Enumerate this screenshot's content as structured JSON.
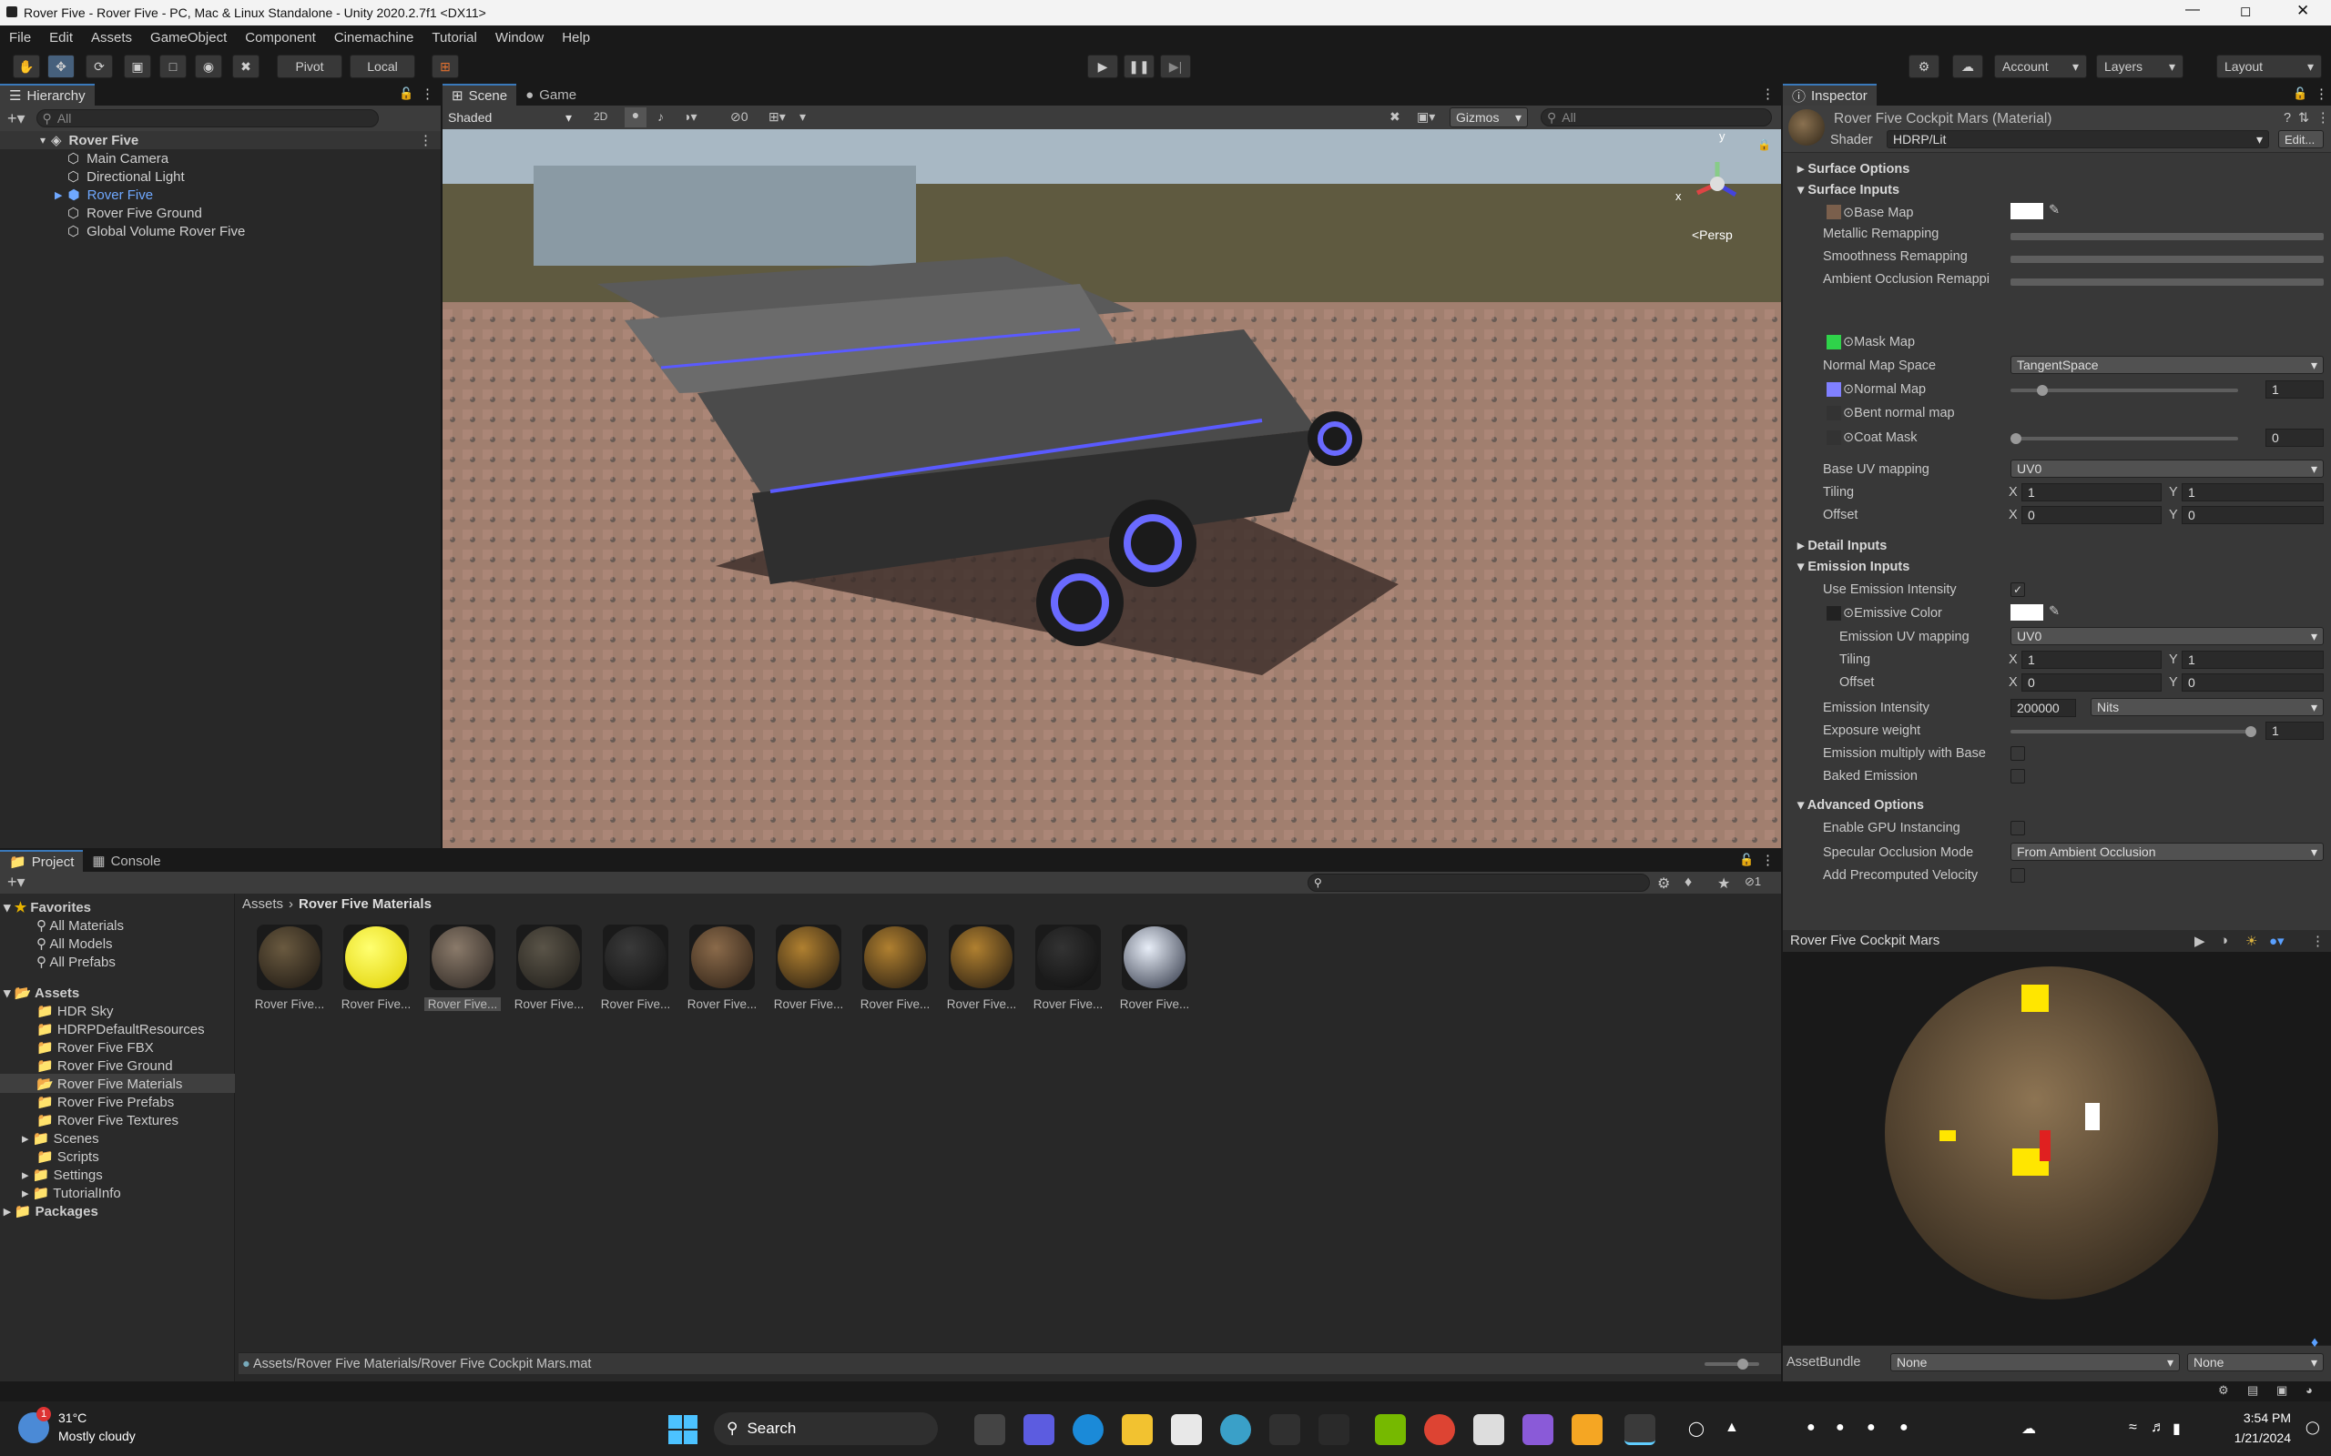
{
  "window": {
    "title": "Rover Five - Rover Five - PC, Mac & Linux Standalone - Unity 2020.2.7f1 <DX11>"
  },
  "menu": [
    "File",
    "Edit",
    "Assets",
    "GameObject",
    "Component",
    "Cinemachine",
    "Tutorial",
    "Window",
    "Help"
  ],
  "toolbar": {
    "pivot": "Pivot",
    "local": "Local",
    "account": "Account",
    "layers": "Layers",
    "layout": "Layout"
  },
  "hierarchy": {
    "tab": "Hierarchy",
    "search_placeholder": "All",
    "scene": "Rover Five",
    "items": [
      "Main Camera",
      "Directional Light",
      "Rover Five",
      "Rover Five Ground",
      "Global Volume Rover Five"
    ]
  },
  "scene": {
    "tab_scene": "Scene",
    "tab_game": "Game",
    "shading": "Shaded",
    "mode2d": "2D",
    "fx_count": "0",
    "gizmos": "Gizmos",
    "search_placeholder": "All",
    "persp": "<Persp",
    "axis_x": "x",
    "axis_y": "y"
  },
  "inspector": {
    "tab": "Inspector",
    "material_name": "Rover Five Cockpit Mars (Material)",
    "shader_label": "Shader",
    "shader_value": "HDRP/Lit",
    "edit": "Edit...",
    "surface_options": "Surface Options",
    "surface_inputs": "Surface Inputs",
    "base_map": "Base Map",
    "metallic_remapping": "Metallic Remapping",
    "smoothness_remapping": "Smoothness Remapping",
    "ao_remapping": "Ambient Occlusion Remappi",
    "mask_map": "Mask Map",
    "normal_map_space": "Normal Map Space",
    "normal_map_space_value": "TangentSpace",
    "normal_map": "Normal Map",
    "normal_map_value": "1",
    "normal_map_level": 0.12,
    "bent_normal_map": "Bent normal map",
    "coat_mask": "Coat Mask",
    "coat_mask_value": "0",
    "coat_mask_level": 0,
    "base_uv_mapping": "Base UV mapping",
    "base_uv_value": "UV0",
    "tiling": "Tiling",
    "offset": "Offset",
    "x": "X",
    "y": "Y",
    "tiling_x": "1",
    "tiling_y": "1",
    "offset_x": "0",
    "offset_y": "0",
    "detail_inputs": "Detail Inputs",
    "emission_inputs": "Emission Inputs",
    "use_emission_intensity": "Use Emission Intensity",
    "emissive_color": "Emissive Color",
    "emission_uv_mapping": "Emission UV mapping",
    "emission_uv_value": "UV0",
    "emission_tiling_x": "1",
    "emission_tiling_y": "1",
    "emission_offset_x": "0",
    "emission_offset_y": "0",
    "emission_intensity": "Emission Intensity",
    "emission_intensity_value": "200000",
    "emission_unit": "Nits",
    "exposure_weight": "Exposure weight",
    "exposure_weight_value": "1",
    "exposure_weight_level": 1,
    "emission_multiply": "Emission multiply with Base",
    "baked_emission": "Baked Emission",
    "advanced_options": "Advanced Options",
    "enable_gpu_instancing": "Enable GPU Instancing",
    "specular_occlusion_mode": "Specular Occlusion Mode",
    "specular_occlusion_value": "From Ambient Occlusion",
    "add_precomputed_velocity": "Add Precomputed Velocity"
  },
  "preview": {
    "title": "Rover Five Cockpit Mars",
    "assetbundle": "AssetBundle",
    "bundle_value": "None",
    "variant_value": "None"
  },
  "project": {
    "tab_project": "Project",
    "tab_console": "Console",
    "favorites": "Favorites",
    "fav_items": [
      "All Materials",
      "All Models",
      "All Prefabs"
    ],
    "assets": "Assets",
    "asset_folders": [
      "HDR Sky",
      "HDRPDefaultResources",
      "Rover Five FBX",
      "Rover Five Ground",
      "Rover Five Materials",
      "Rover Five Prefabs",
      "Rover Five Textures",
      "Scenes",
      "Scripts",
      "Settings",
      "TutorialInfo"
    ],
    "packages": "Packages",
    "breadcrumb_root": "Assets",
    "breadcrumb_current": "Rover Five Materials",
    "hidden_count": "1",
    "asset_label": "Rover Five...",
    "asset_count": 11,
    "status_path": "Assets/Rover Five Materials/Rover Five Cockpit Mars.mat"
  },
  "taskbar": {
    "weather_temp": "31°C",
    "weather_text": "Mostly cloudy",
    "weather_badge": "1",
    "search": "Search",
    "time": "3:54 PM",
    "date": "1/21/2024"
  },
  "colors": {
    "accent": "#3a79bb",
    "selected_item": "#2c5d87",
    "rover_text": "#6fa8ff"
  }
}
